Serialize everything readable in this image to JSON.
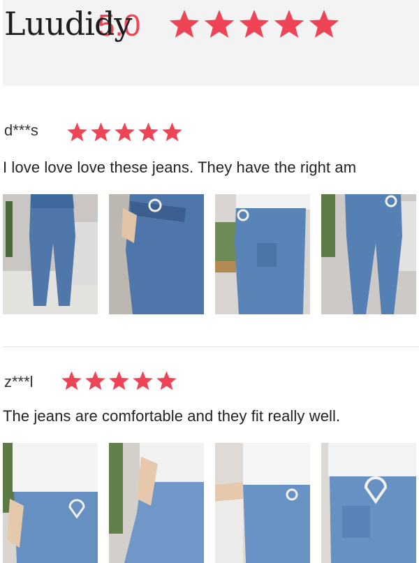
{
  "summary": {
    "brand_overlay": "Luudidy",
    "score": "5.0",
    "stars": 5,
    "star_color": "#ee4455"
  },
  "reviews": [
    {
      "name": "d***s",
      "stars": 5,
      "text": "I love love love these jeans. They have the right am",
      "photos": [
        "jeans-photo-1",
        "jeans-photo-2",
        "jeans-photo-3",
        "jeans-photo-4"
      ]
    },
    {
      "name": "z***l",
      "stars": 5,
      "text": "The jeans are comfortable and they fit really well.",
      "photos": [
        "jeans-photo-1",
        "jeans-photo-2",
        "jeans-photo-3",
        "jeans-photo-4"
      ]
    }
  ]
}
